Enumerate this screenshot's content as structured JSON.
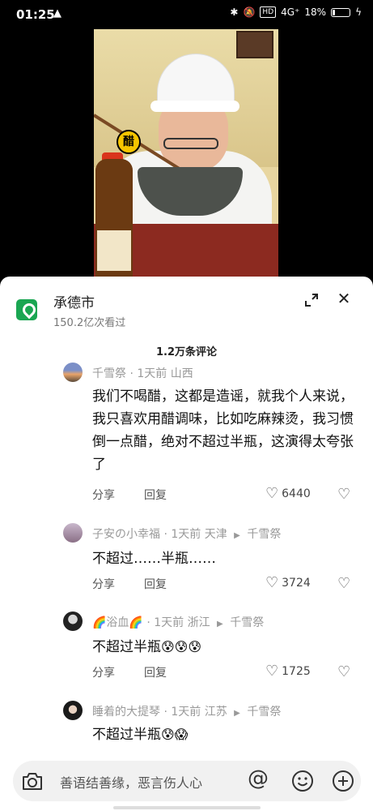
{
  "status_bar": {
    "time": "01:25",
    "warning": "▲",
    "hd": "HD",
    "signal": "4G⁺",
    "battery": "18%",
    "battery_level": 0.18
  },
  "video": {
    "sticker_text": "醋"
  },
  "location": {
    "name": "承德市",
    "views": "150.2亿次看过"
  },
  "comment_count": "1.2万条评论",
  "comments": [
    {
      "user": "千雪祭",
      "meta": "· 1天前 山西",
      "reply_to": "",
      "text": "我们不喝醋，这都是造谣，就我个人来说，我只喜欢用醋调味，比如吃麻辣烫，我习惯倒一点醋，绝对不超过半瓶，这演得太夸张了",
      "share": "分享",
      "reply": "回复",
      "likes": "6440"
    },
    {
      "user": "子安の小幸福",
      "meta": "· 1天前 天津",
      "reply_to": "千雪祭",
      "text": "不超过……半瓶……",
      "share": "分享",
      "reply": "回复",
      "likes": "3724"
    },
    {
      "user": "🌈浴血🌈",
      "meta": "· 1天前 浙江",
      "reply_to": "千雪祭",
      "text": "不超过半瓶",
      "emoji": "😰😰😰",
      "share": "分享",
      "reply": "回复",
      "likes": "1725"
    },
    {
      "user": "睡着的大提琴",
      "meta": "· 1天前 江苏",
      "reply_to": "千雪祭",
      "text": "不超过半瓶",
      "emoji": "😰😱"
    }
  ],
  "input": {
    "placeholder": "善语结善缘，恶言伤人心",
    "at_symbol": "@"
  },
  "icons": {
    "location": "location-pin-icon",
    "expand": "expand-icon",
    "close": "close-icon",
    "like": "heart-outline-icon",
    "dislike": "broken-heart-icon",
    "camera": "camera-icon",
    "emoji": "smile-icon",
    "more": "plus-icon"
  },
  "colors": {
    "location_badge": "#1aa652",
    "meta_gray": "#999999"
  }
}
